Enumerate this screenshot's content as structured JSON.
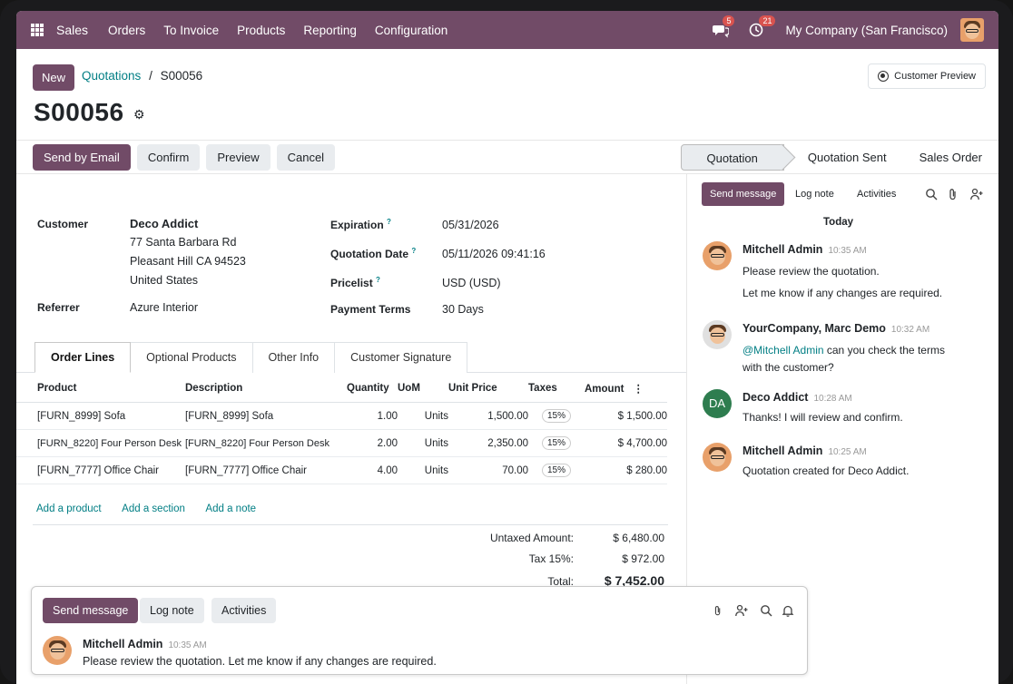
{
  "nav": {
    "brand": "Sales",
    "items": [
      "Orders",
      "To Invoice",
      "Products",
      "Reporting",
      "Configuration"
    ],
    "messages_count": "5",
    "activities_count": "21",
    "company": "My Company (San Francisco)"
  },
  "header": {
    "new_label": "New",
    "breadcrumb_parent": "Quotations",
    "breadcrumb_sep": "/",
    "breadcrumb_current": "S00056",
    "title": "S00056",
    "customer_preview": "Customer Preview"
  },
  "actions": {
    "send_email": "Send by Email",
    "confirm": "Confirm",
    "preview": "Preview",
    "cancel": "Cancel"
  },
  "status": {
    "steps": [
      "Quotation",
      "Quotation Sent",
      "Sales Order"
    ],
    "active": "Quotation"
  },
  "form": {
    "customer_label": "Customer",
    "customer_name": "Deco Addict",
    "address1": "77 Santa Barbara Rd",
    "address2": "Pleasant Hill CA 94523",
    "address3": "United States",
    "referrer_label": "Referrer",
    "referrer": "Azure Interior",
    "expiration_label": "Expiration",
    "expiration": "05/31/2026",
    "quotation_date_label": "Quotation Date",
    "quotation_date": "05/11/2026 09:41:16",
    "pricelist_label": "Pricelist",
    "pricelist": "USD (USD)",
    "payment_terms_label": "Payment Terms",
    "payment_terms": "30 Days",
    "help_mark": "?"
  },
  "tabs": [
    "Order Lines",
    "Optional Products",
    "Other Info",
    "Customer Signature"
  ],
  "lines": {
    "headers": [
      "Product",
      "Description",
      "Quantity",
      "UoM",
      "Unit Price",
      "Taxes",
      "Amount"
    ],
    "rows": [
      {
        "product": "[FURN_8999] Sofa",
        "description": "[FURN_8999] Sofa",
        "qty": "1.00",
        "uom": "Units",
        "price": "1,500.00",
        "tax": "15%",
        "amount": "$ 1,500.00"
      },
      {
        "product": "[FURN_8220] Four Person Desk",
        "description": "[FURN_8220] Four Person Desk",
        "qty": "2.00",
        "uom": "Units",
        "price": "2,350.00",
        "tax": "15%",
        "amount": "$ 4,700.00"
      },
      {
        "product": "[FURN_7777] Office Chair",
        "description": "[FURN_7777] Office Chair",
        "qty": "4.00",
        "uom": "Units",
        "price": "70.00",
        "tax": "15%",
        "amount": "$ 280.00"
      }
    ],
    "add_product": "Add a product",
    "add_section": "Add a section",
    "add_note": "Add a note"
  },
  "totals": {
    "untaxed_label": "Untaxed Amount:",
    "untaxed": "$ 6,480.00",
    "tax_label": "Tax 15%:",
    "tax": "$ 972.00",
    "total_label": "Total:",
    "total": "$ 7,452.00"
  },
  "chatter": {
    "send_message": "Send message",
    "log_note": "Log note",
    "activities": "Activities",
    "day": "Today",
    "messages": [
      {
        "author": "Mitchell Admin",
        "time": "10:35 AM",
        "line1": "Please review the quotation.",
        "line2": "Let me know if any changes are required."
      },
      {
        "author": "YourCompany, Marc Demo",
        "time": "10:32 AM",
        "mention": "@Mitchell Admin",
        "line1": " can you check the terms",
        "line2": "with the customer?"
      },
      {
        "author": "Deco Addict",
        "initials": "DA",
        "time": "10:28 AM",
        "line1": "Thanks! I will review and confirm."
      },
      {
        "author": "Mitchell Admin",
        "time": "10:25 AM",
        "line1": "Quotation created for Deco Addict."
      }
    ]
  },
  "composer": {
    "send_message": "Send message",
    "log_note": "Log note",
    "activities": "Activities",
    "author": "Mitchell Admin",
    "time": "10:35 AM",
    "text": "Please review the quotation. Let me know if any changes are required."
  }
}
